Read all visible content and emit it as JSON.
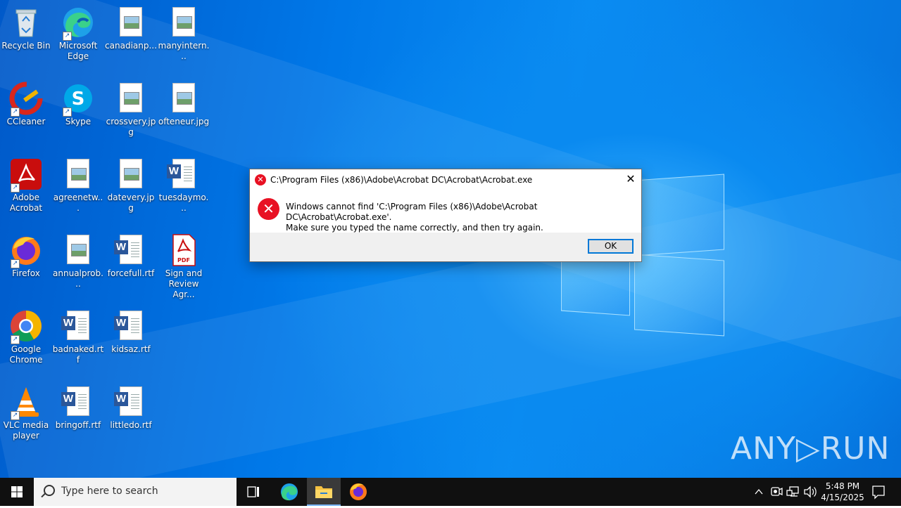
{
  "desktop": {
    "icons": [
      {
        "label": "Recycle Bin",
        "icon": "recycle-bin-icon"
      },
      {
        "label": "Microsoft Edge",
        "icon": "edge-icon"
      },
      {
        "label": "canadianp...",
        "icon": "image-file-icon"
      },
      {
        "label": "manyintern...",
        "icon": "image-file-icon"
      },
      {
        "label": "CCleaner",
        "icon": "ccleaner-icon"
      },
      {
        "label": "Skype",
        "icon": "skype-icon"
      },
      {
        "label": "crossvery.jpg",
        "icon": "image-file-icon"
      },
      {
        "label": "ofteneur.jpg",
        "icon": "image-file-icon"
      },
      {
        "label": "Adobe Acrobat",
        "icon": "acrobat-icon"
      },
      {
        "label": "agreenetw...",
        "icon": "image-file-icon"
      },
      {
        "label": "datevery.jpg",
        "icon": "image-file-icon"
      },
      {
        "label": "tuesdaymo...",
        "icon": "word-file-icon"
      },
      {
        "label": "Firefox",
        "icon": "firefox-icon"
      },
      {
        "label": "annualprob...",
        "icon": "image-file-icon"
      },
      {
        "label": "forcefull.rtf",
        "icon": "word-file-icon"
      },
      {
        "label": "Sign and Review Agr...",
        "icon": "pdf-file-icon"
      },
      {
        "label": "Google Chrome",
        "icon": "chrome-icon"
      },
      {
        "label": "badnaked.rtf",
        "icon": "word-file-icon"
      },
      {
        "label": "kidsaz.rtf",
        "icon": "word-file-icon"
      },
      {
        "label": "VLC media player",
        "icon": "vlc-icon"
      },
      {
        "label": "bringoff.rtf",
        "icon": "word-file-icon"
      },
      {
        "label": "littledo.rtf",
        "icon": "word-file-icon"
      }
    ]
  },
  "dialog": {
    "title": "C:\\Program Files (x86)\\Adobe\\Acrobat DC\\Acrobat\\Acrobat.exe",
    "message_line1": "Windows cannot find 'C:\\Program Files (x86)\\Adobe\\Acrobat DC\\Acrobat\\Acrobat.exe'.",
    "message_line2": "Make sure you typed the name correctly, and then try again.",
    "ok_label": "OK",
    "close_glyph": "✕",
    "error_glyph": "✕"
  },
  "watermark": {
    "text": "ANY▷RUN"
  },
  "taskbar": {
    "search_placeholder": "Type here to search",
    "time": "5:48 PM",
    "date": "4/15/2025"
  }
}
